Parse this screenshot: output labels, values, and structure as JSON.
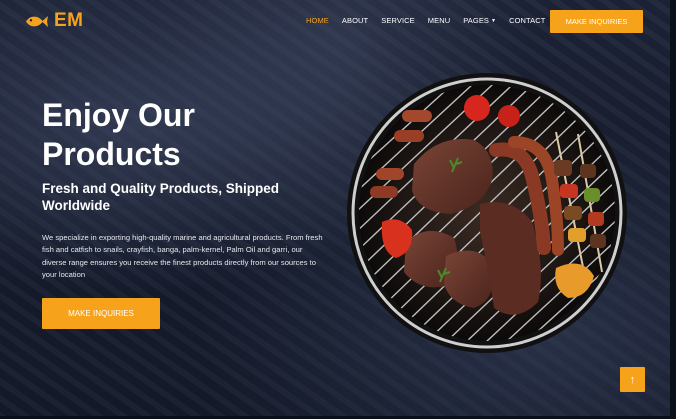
{
  "brand": {
    "name": "EM",
    "icon": "fish-icon",
    "color": "#f7a21b"
  },
  "nav": {
    "items": [
      {
        "label": "HOME",
        "active": true
      },
      {
        "label": "ABOUT",
        "active": false
      },
      {
        "label": "SERVICE",
        "active": false
      },
      {
        "label": "MENU",
        "active": false
      },
      {
        "label": "PAGES",
        "active": false,
        "dropdown": true
      },
      {
        "label": "CONTACT",
        "active": false
      }
    ],
    "cta_label": "MAKE INQUIRIES"
  },
  "hero": {
    "title_line1": "Enjoy Our",
    "title_line2": "Products",
    "subtitle": "Fresh and Quality Products, Shipped Worldwide",
    "description": "We specialize in exporting high-quality marine and agricultural products. From fresh fish and catfish to snails, crayfish, banga, palm-kernel, Palm Oil and garri, our diverse range ensures you receive the finest products directly from our sources to your location",
    "cta_label": "MAKE INQUIRIES",
    "image": "grill-meat-image"
  },
  "back_to_top": {
    "icon": "arrow-up-icon",
    "glyph": "↑"
  },
  "colors": {
    "accent": "#f7a21b",
    "background": "#171d2e",
    "text": "#ffffff"
  }
}
